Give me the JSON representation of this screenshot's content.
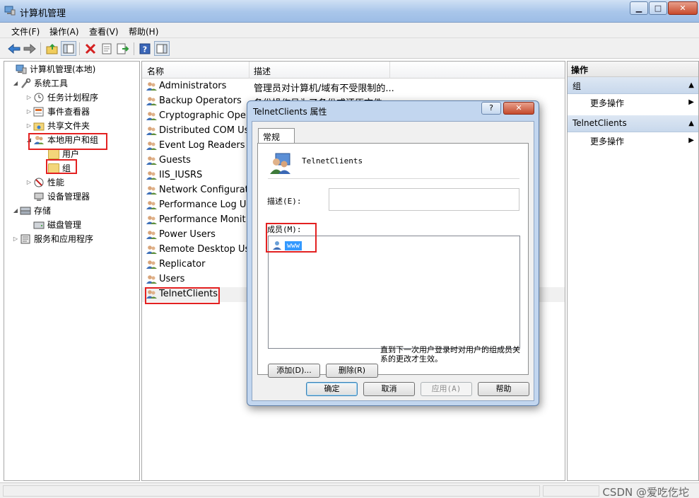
{
  "window": {
    "title": "计算机管理",
    "controls": [
      "▁",
      "□",
      "✕"
    ]
  },
  "menubar": [
    "文件(F)",
    "操作(A)",
    "查看(V)",
    "帮助(H)"
  ],
  "toolbar_icons": [
    "back-arrow-icon",
    "forward-arrow-icon",
    "up-folder-icon",
    "show-hide-tree-icon",
    "delete-icon",
    "properties-icon",
    "export-list-icon",
    "help-icon",
    "show-hide-action-pane-icon"
  ],
  "tree": [
    {
      "label": "计算机管理(本地)",
      "level": 0,
      "expander": "",
      "icon": "computer-icon"
    },
    {
      "label": "系统工具",
      "level": 1,
      "expander": "◢",
      "icon": "tools-icon"
    },
    {
      "label": "任务计划程序",
      "level": 2,
      "expander": "▷",
      "icon": "clock-icon"
    },
    {
      "label": "事件查看器",
      "level": 2,
      "expander": "▷",
      "icon": "event-viewer-icon"
    },
    {
      "label": "共享文件夹",
      "level": 2,
      "expander": "▷",
      "icon": "shared-folder-icon"
    },
    {
      "label": "本地用户和组",
      "level": 2,
      "expander": "◢",
      "icon": "users-icon"
    },
    {
      "label": "用户",
      "level": 3,
      "expander": "",
      "icon": "folder-icon"
    },
    {
      "label": "组",
      "level": 3,
      "expander": "",
      "icon": "folder-icon"
    },
    {
      "label": "性能",
      "level": 2,
      "expander": "▷",
      "icon": "performance-icon"
    },
    {
      "label": "设备管理器",
      "level": 2,
      "expander": "",
      "icon": "device-manager-icon"
    },
    {
      "label": "存储",
      "level": 1,
      "expander": "◢",
      "icon": "storage-icon"
    },
    {
      "label": "磁盘管理",
      "level": 2,
      "expander": "",
      "icon": "disk-icon"
    },
    {
      "label": "服务和应用程序",
      "level": 1,
      "expander": "▷",
      "icon": "services-icon"
    }
  ],
  "list": {
    "columns": [
      "名称",
      "描述"
    ],
    "rows": [
      {
        "name": "Administrators",
        "desc": "管理员对计算机/域有不受限制的..."
      },
      {
        "name": "Backup Operators",
        "desc": "备份操作员为了备份或还原文件..."
      },
      {
        "name": "Cryptographic Oper...",
        "desc": ""
      },
      {
        "name": "Distributed COM Us...",
        "desc": ""
      },
      {
        "name": "Event Log Readers",
        "desc": ""
      },
      {
        "name": "Guests",
        "desc": ""
      },
      {
        "name": "IIS_IUSRS",
        "desc": ""
      },
      {
        "name": "Network Configurat...",
        "desc": ""
      },
      {
        "name": "Performance Log U...",
        "desc": ""
      },
      {
        "name": "Performance Monit...",
        "desc": ""
      },
      {
        "name": "Power Users",
        "desc": ""
      },
      {
        "name": "Remote Desktop Us...",
        "desc": ""
      },
      {
        "name": "Replicator",
        "desc": ""
      },
      {
        "name": "Users",
        "desc": ""
      },
      {
        "name": "TelnetClients",
        "desc": ""
      }
    ]
  },
  "actions": {
    "title": "操作",
    "sections": [
      {
        "label": "组",
        "item": "更多操作"
      },
      {
        "label": "TelnetClients",
        "item": "更多操作"
      }
    ]
  },
  "dialog": {
    "title": "TelnetClients 属性",
    "help_btn": "?",
    "close_btn": "✕",
    "tab": "常规",
    "group_name": "TelnetClients",
    "desc_label": "描述(E):",
    "desc_value": "",
    "members_label": "成员(M):",
    "members": [
      "www"
    ],
    "add_btn": "添加(D)...",
    "remove_btn": "删除(R)",
    "note": "直到下一次用户登录时对用户的组成员关系的更改才生效。",
    "ok_btn": "确定",
    "cancel_btn": "取消",
    "apply_btn": "应用(A)",
    "help_text_btn": "帮助"
  },
  "watermark": "CSDN @爱吃仡坨",
  "colors": {
    "highlight_red": "#e32121",
    "selection_blue": "#3399ff"
  }
}
